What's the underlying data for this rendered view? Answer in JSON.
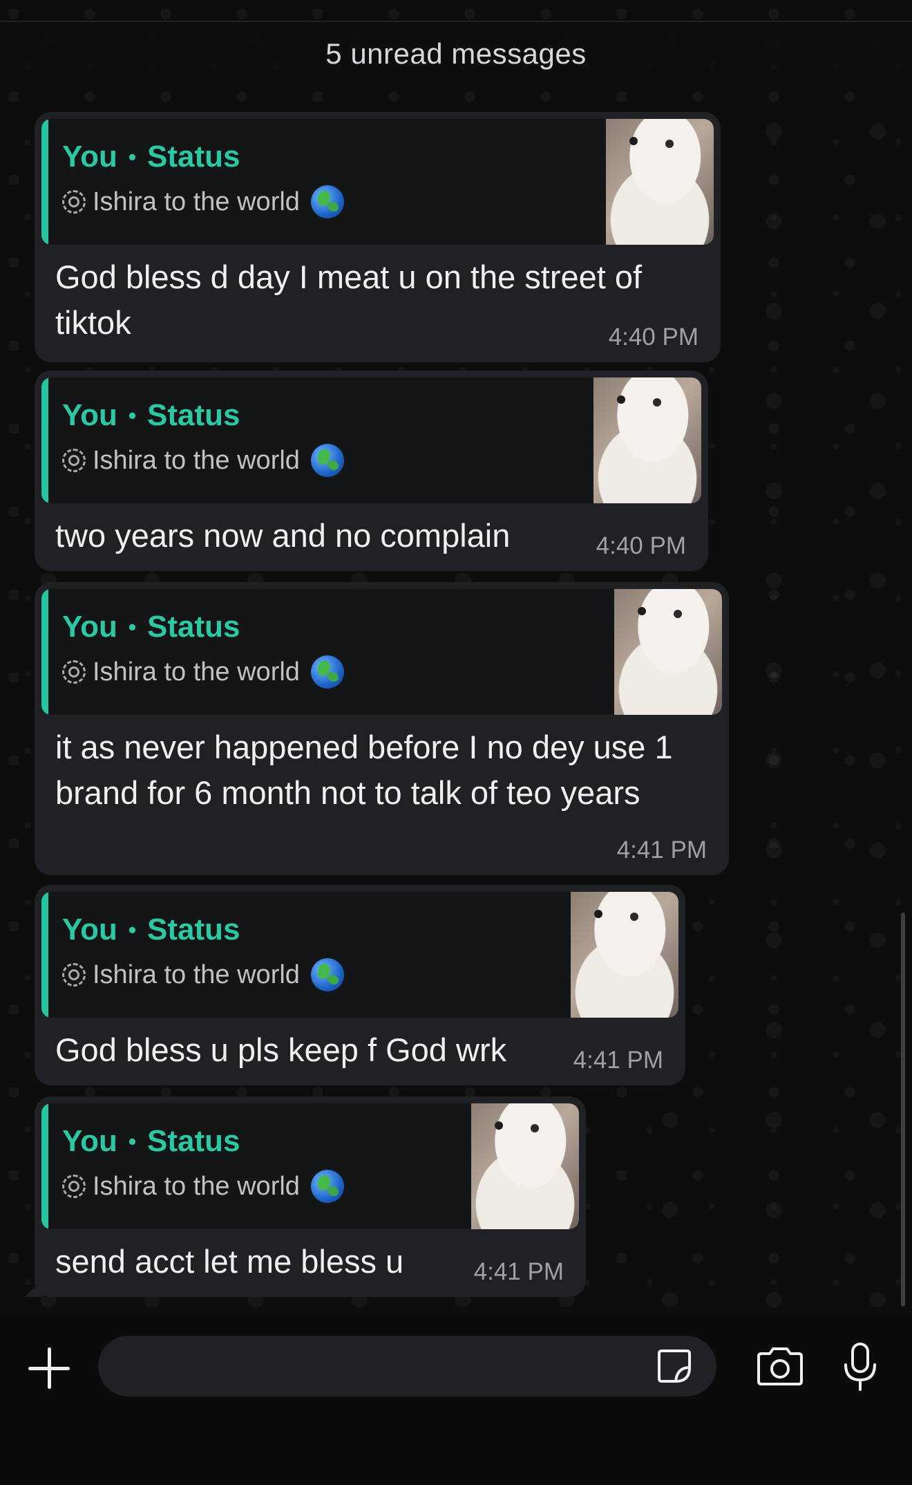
{
  "banner": {
    "unread": "5 unread messages"
  },
  "messages": [
    {
      "quote_from": "You",
      "quote_type": "Status",
      "quote_text": "Ishira to the world",
      "text": "God bless d day I meat u on the street of tiktok",
      "time": "4:40 PM"
    },
    {
      "quote_from": "You",
      "quote_type": "Status",
      "quote_text": "Ishira to the world",
      "text": "two  years  now and no complain",
      "time": "4:40 PM"
    },
    {
      "quote_from": "You",
      "quote_type": "Status",
      "quote_text": "Ishira to the world",
      "text": "it as never happened before  I no dey use 1 brand for 6 month not to talk of teo years",
      "time": "4:41 PM"
    },
    {
      "quote_from": "You",
      "quote_type": "Status",
      "quote_text": "Ishira to the world",
      "text": "God bless u pls keep f God wrk",
      "time": "4:41 PM"
    },
    {
      "quote_from": "You",
      "quote_type": "Status",
      "quote_text": "Ishira to the world",
      "text": "send acct let me bless  u",
      "time": "4:41 PM"
    }
  ],
  "input": {
    "placeholder": ""
  },
  "icons": {
    "status": "status-icon",
    "globe": "globe-emoji-icon",
    "plus": "plus-icon",
    "sticker": "sticker-icon",
    "camera": "camera-icon",
    "mic": "microphone-icon"
  },
  "colors": {
    "accent": "#25c5a0",
    "bubble": "#1f2124",
    "quote_bg": "#141517",
    "background": "#0d0d0d"
  }
}
